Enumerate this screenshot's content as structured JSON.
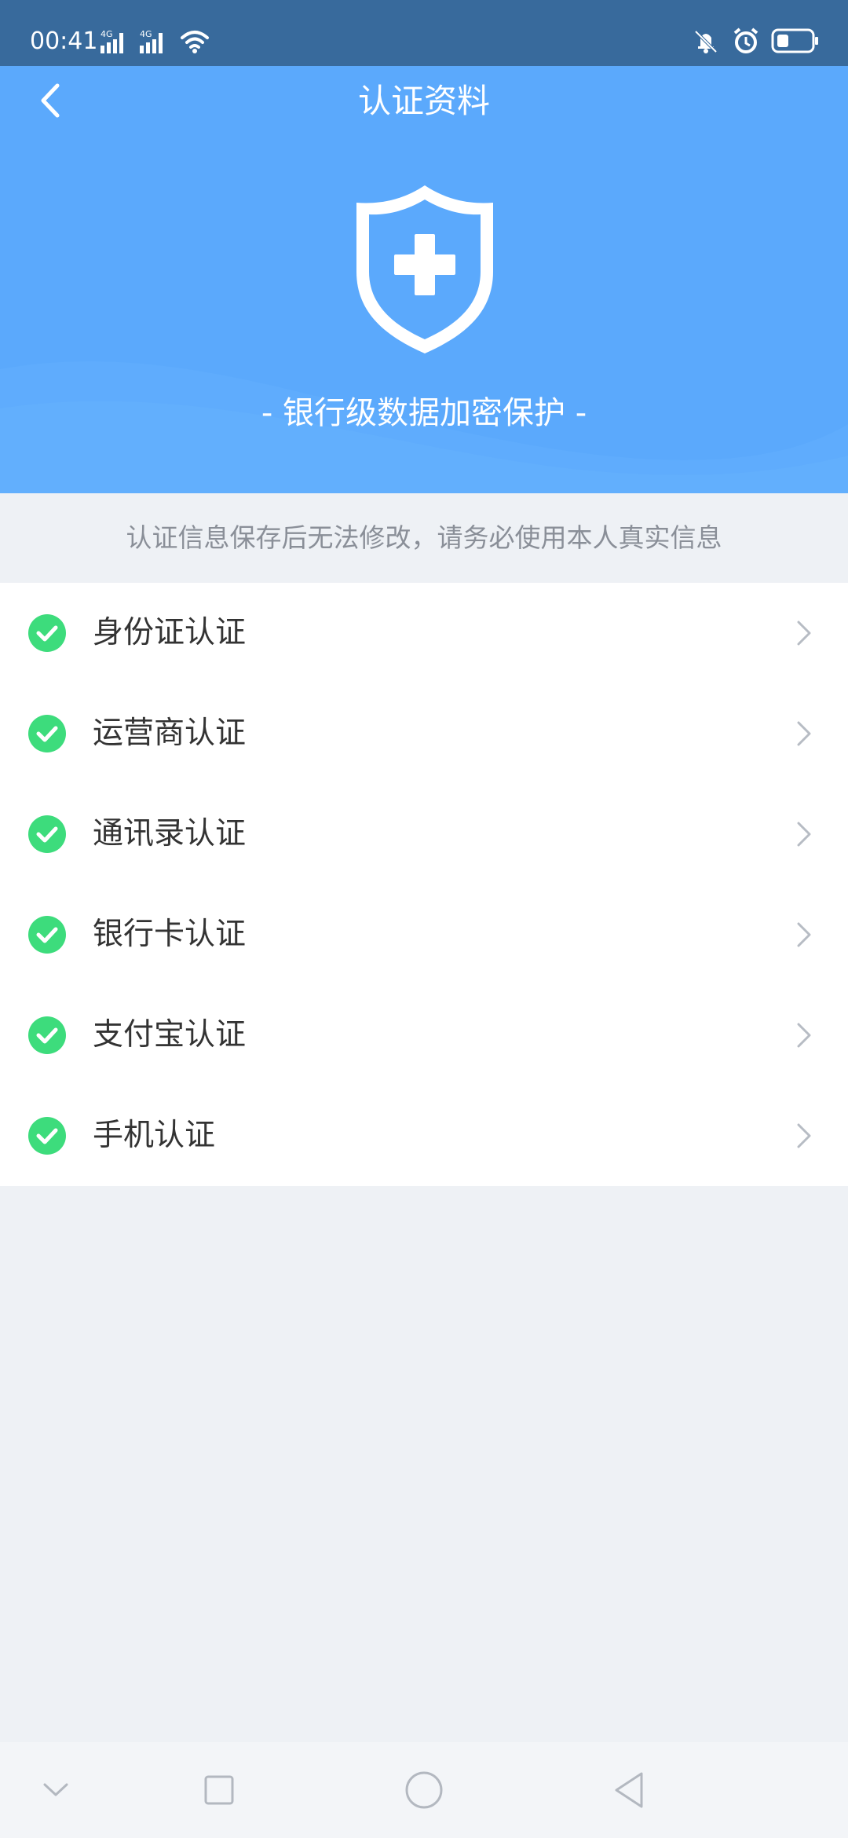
{
  "status_bar": {
    "time": "00:41",
    "network_1": "4G",
    "network_2": "4G",
    "icons": [
      "signal-icon",
      "signal-icon",
      "wifi-icon",
      "mute-vibrate-icon",
      "alarm-icon",
      "battery-icon"
    ]
  },
  "header": {
    "title": "认证资料",
    "back_icon": "chevron-left-icon"
  },
  "hero": {
    "icon": "shield-plus-icon",
    "tagline": "- 银行级数据加密保护 -"
  },
  "notice": "认证信息保存后无法修改，请务必使用本人真实信息",
  "auth_items": [
    {
      "label": "身份证认证",
      "status_icon": "check-circle-icon",
      "status": "verified"
    },
    {
      "label": "运营商认证",
      "status_icon": "check-circle-icon",
      "status": "verified"
    },
    {
      "label": "通讯录认证",
      "status_icon": "check-circle-icon",
      "status": "verified"
    },
    {
      "label": "银行卡认证",
      "status_icon": "check-circle-icon",
      "status": "verified"
    },
    {
      "label": "支付宝认证",
      "status_icon": "check-circle-icon",
      "status": "verified"
    },
    {
      "label": "手机认证",
      "status_icon": "check-circle-icon",
      "status": "verified"
    }
  ],
  "system_nav": {
    "buttons": [
      "hide-keyboard-icon",
      "recents-icon",
      "home-icon",
      "back-icon"
    ]
  },
  "colors": {
    "status_bar": "#386a9c",
    "header_bg": "#5ba9fc",
    "check_green": "#3ddc7c",
    "page_bg": "#eef1f5"
  }
}
